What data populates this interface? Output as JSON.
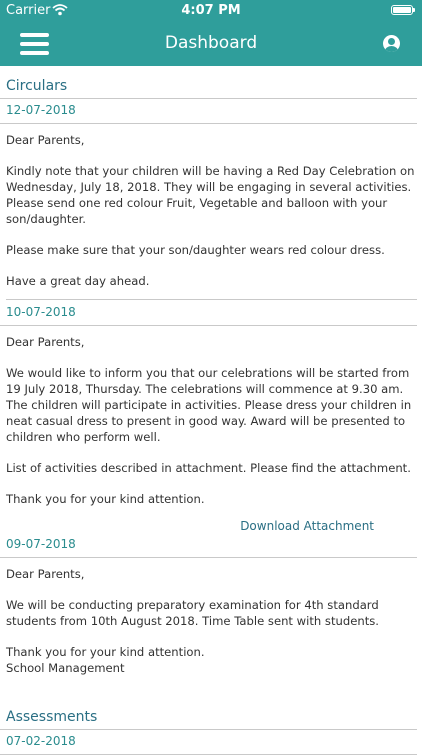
{
  "status": {
    "carrier": "Carrier",
    "time": "4:07 PM"
  },
  "nav": {
    "title": "Dashboard"
  },
  "circulars": {
    "title": "Circulars",
    "items": [
      {
        "date": "12-07-2018",
        "greeting": "Dear Parents,",
        "p1": "Kindly note that your children will be having a Red Day Celebration on Wednesday, July 18, 2018. They will be engaging in several activities. Please send one red colour Fruit, Vegetable and balloon with your son/daughter.",
        "p2": "Please make sure that your son/daughter wears red colour dress.",
        "p3": "Have a great day ahead."
      },
      {
        "date": "10-07-2018",
        "greeting": "Dear Parents,",
        "p1": "We would like to inform you that our celebrations will be started from 19 July 2018, Thursday. The celebrations will commence at 9.30 am. The children will participate in activities. Please dress your children in neat casual dress to present in good way. Award will be presented to children who perform well.",
        "p2": "List of activities described in attachment. Please find the attachment.",
        "p3": "Thank you for your kind attention.",
        "attachment": "Download Attachment"
      },
      {
        "date": "09-07-2018",
        "greeting": "Dear Parents,",
        "p1": "We will be conducting preparatory examination for 4th standard students from 10th August 2018. Time Table sent with students.",
        "p2": "Thank you for your kind attention.",
        "p3": "School Management"
      }
    ]
  },
  "assessments": {
    "title": "Assessments",
    "items": [
      {
        "date": "07-02-2018"
      }
    ]
  }
}
